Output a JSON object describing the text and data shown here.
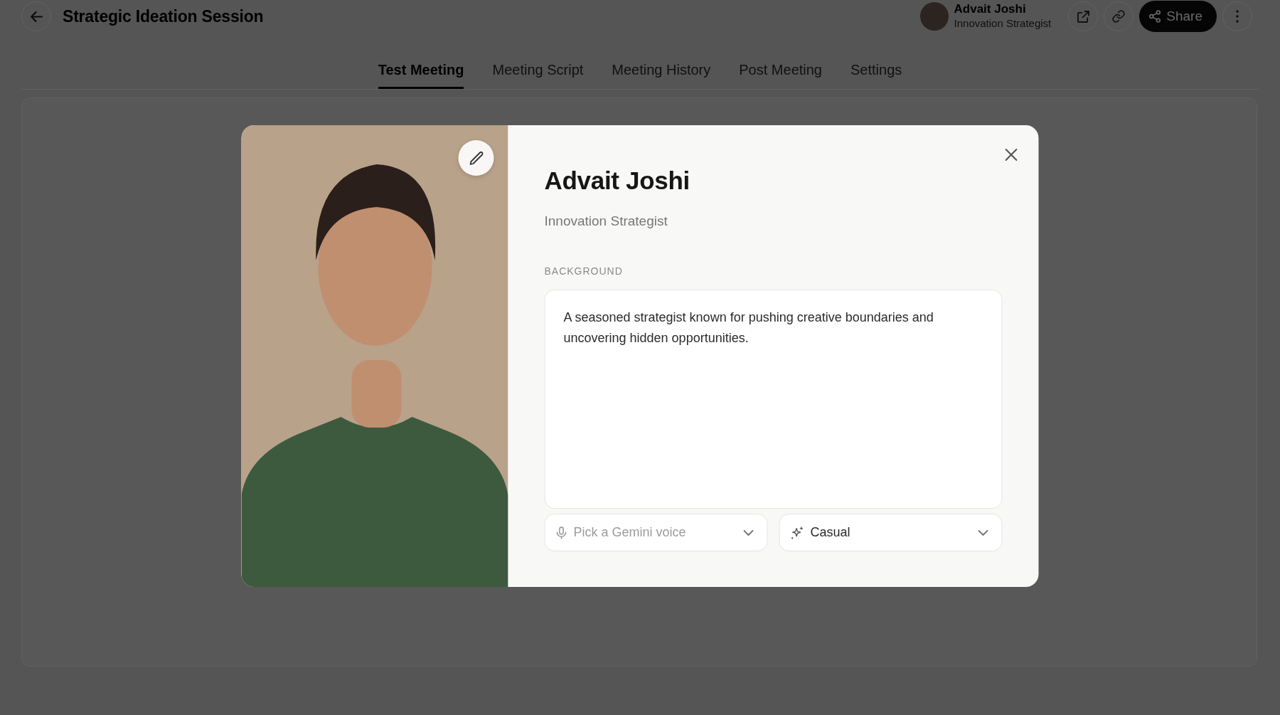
{
  "header": {
    "title": "Strategic Ideation Session",
    "user": {
      "name": "Advait Joshi",
      "role": "Innovation Strategist"
    },
    "share_label": "Share"
  },
  "tabs": [
    {
      "label": "Test Meeting",
      "selected": true
    },
    {
      "label": "Meeting Script",
      "selected": false
    },
    {
      "label": "Meeting History",
      "selected": false
    },
    {
      "label": "Post Meeting",
      "selected": false
    },
    {
      "label": "Settings",
      "selected": false
    }
  ],
  "profile_dialog": {
    "name": "Advait Joshi",
    "role": "Innovation Strategist",
    "background_label": "BACKGROUND",
    "background_text": "A seasoned strategist known for pushing creative boundaries and uncovering hidden opportunities.",
    "voice_select": {
      "placeholder": "Pick a Gemini voice"
    },
    "tone_select": {
      "value": "Casual"
    }
  }
}
